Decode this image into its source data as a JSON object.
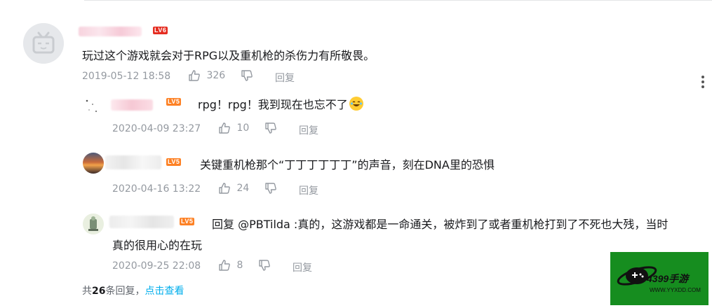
{
  "main_comment": {
    "level_badge": "LV6",
    "text": "玩过这个游戏就会对于RPG以及重机枪的杀伤力有所敬畏。",
    "date": "2019-05-12 18:58",
    "likes": "326",
    "reply_label": "回复"
  },
  "replies": [
    {
      "level_badge": "LV5",
      "text": "rpg！rpg！我到现在也忘不了",
      "date": "2020-04-09 23:27",
      "likes": "10",
      "reply_label": "回复"
    },
    {
      "level_badge": "LV5",
      "text": "关键重机枪那个“丁丁丁丁丁丁”的声音，刻在DNA里的恐惧",
      "date": "2020-04-16 13:22",
      "likes": "24",
      "reply_label": "回复"
    },
    {
      "level_badge": "LV5",
      "text_line1": "回复 @PBTilda :真的，这游戏都是一命通关，被炸到了或者重机枪打到了不死也大残，当时",
      "text_line2": "真的很用心的在玩",
      "date": "2020-09-25 22:08",
      "likes": "8",
      "reply_label": "回复"
    }
  ],
  "footer": {
    "prefix": "共",
    "count": "26",
    "suffix": "条回复，",
    "link": "点击查看"
  },
  "watermark": {
    "brand": "4399手游",
    "url": "WWW.YYXDD.COM"
  },
  "colors": {
    "link": "#00aeec",
    "meta": "#9499a0",
    "lv5": "#fd8125",
    "lv6": "#e52c20",
    "watermark_bg": "#168d1f"
  }
}
